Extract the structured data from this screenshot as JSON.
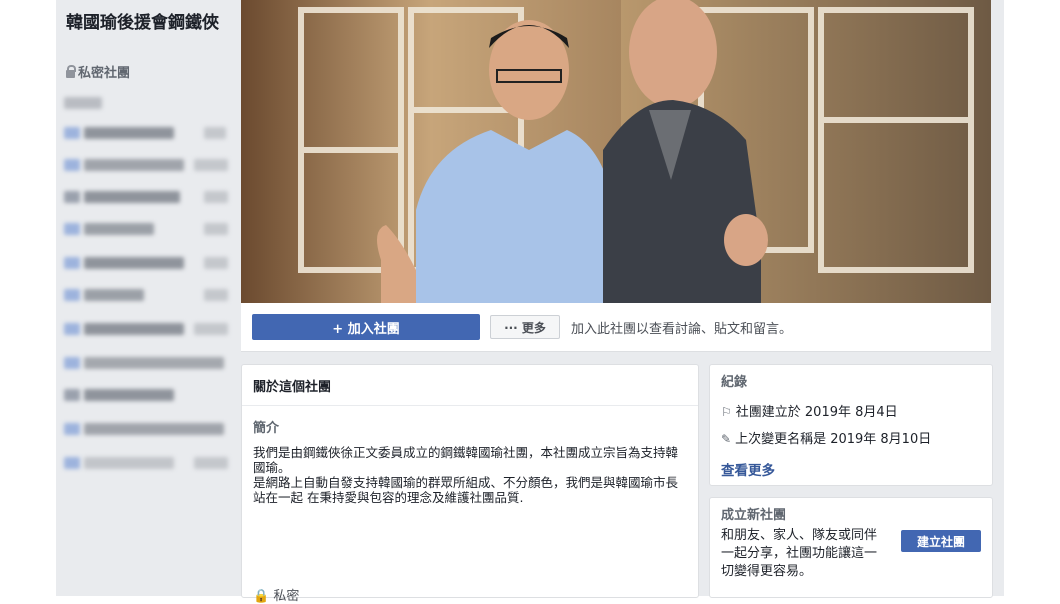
{
  "sidebar": {
    "group_name": "韓國瑜後援會鋼鐵俠",
    "privacy_label": "私密社團"
  },
  "cover": {
    "icon": "group-cover-photo"
  },
  "actions": {
    "join_label": "+ 加入社團",
    "more_label": "··· 更多",
    "join_hint": "加入此社團以查看討論、貼文和留言。"
  },
  "about": {
    "title": "關於這個社團",
    "intro_label": "簡介",
    "description_1": "我們是由鋼鐵俠徐正文委員成立的鋼鐵韓國瑜社團，本社團成立宗旨為支持韓國瑜。",
    "description_2": "是網路上自動自發支持韓國瑜的群眾所組成、不分顏色，我們是與韓國瑜市長站在一起 在秉持愛與包容的理念及維護社團品質.",
    "privacy_label": "私密"
  },
  "records": {
    "title": "紀錄",
    "created": "社團建立於 2019年 8月4日",
    "renamed": "上次變更名稱是 2019年 8月10日",
    "see_more": "查看更多"
  },
  "new_group": {
    "title": "成立新社團",
    "text": "和朋友、家人、隊友或同伴一起分享，社團功能讓這一切變得更容易。",
    "button_label": "建立社團"
  },
  "colors": {
    "brand_blue": "#4267b2",
    "link_blue": "#365899",
    "page_bg": "#e9ebee"
  }
}
